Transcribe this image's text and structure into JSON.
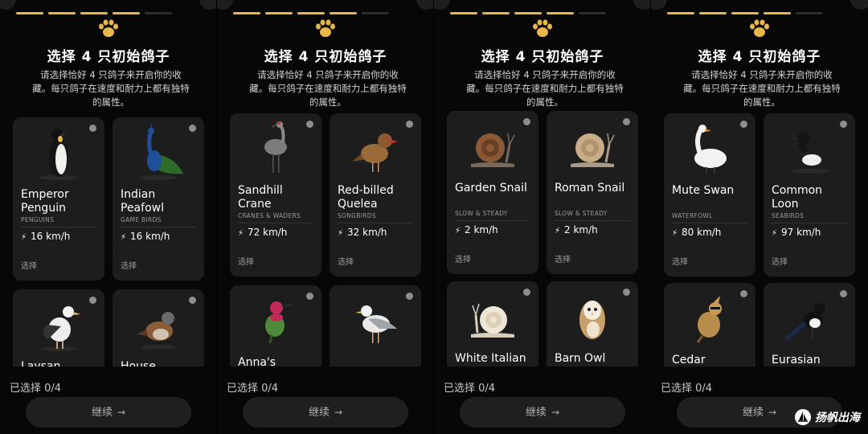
{
  "header": {
    "title": "选择 4 只初始鸽子",
    "subtitle": "请选择恰好 4 只鸽子来开启你的收藏。每只鸽子在速度和耐力上都有独特的属性。"
  },
  "common": {
    "choose_label": "选择",
    "selected_count": "已选择 0/4",
    "continue_label": "继续",
    "progress": {
      "filled": 4,
      "total": 5
    },
    "accent_color": "#e8b64a",
    "icons": {
      "paw": "paw-icon",
      "bolt": "bolt-icon",
      "arrow": "arrow-right-icon"
    }
  },
  "panels": [
    {
      "cards": [
        {
          "name": "Emperor Penguin",
          "category": "PENGUINS",
          "speed": "16 km/h",
          "icon": "penguin-icon"
        },
        {
          "name": "Indian Peafowl",
          "category": "GAME BIRDS",
          "speed": "16 km/h",
          "icon": "peafowl-icon"
        },
        {
          "name": "Laysan",
          "icon": "albatross-icon"
        },
        {
          "name": "House",
          "icon": "sparrow-icon"
        }
      ]
    },
    {
      "cards": [
        {
          "name": "Sandhill Crane",
          "category": "CRANES & WADERS",
          "speed": "72 km/h",
          "icon": "crane-icon"
        },
        {
          "name": "Red-billed Quelea",
          "category": "SONGBIRDS",
          "speed": "32 km/h",
          "icon": "quelea-icon"
        },
        {
          "name": "Anna's",
          "icon": "hummingbird-icon"
        },
        {
          "name": "",
          "icon": "gull-icon"
        }
      ]
    },
    {
      "cards": [
        {
          "name": "Garden Snail",
          "category": "SLOW & STEADY",
          "speed": "2 km/h",
          "icon": "snail-icon"
        },
        {
          "name": "Roman Snail",
          "category": "SLOW & STEADY",
          "speed": "2 km/h",
          "icon": "snail-icon"
        },
        {
          "name": "White Italian",
          "icon": "white-snail-icon"
        },
        {
          "name": "Barn Owl",
          "icon": "owl-icon"
        }
      ]
    },
    {
      "cards": [
        {
          "name": "Mute Swan",
          "category": "WATERFOWL",
          "speed": "80 km/h",
          "icon": "swan-icon"
        },
        {
          "name": "Common Loon",
          "category": "SEABIRDS",
          "speed": "97 km/h",
          "icon": "loon-icon"
        },
        {
          "name": "Cedar",
          "icon": "waxwing-icon"
        },
        {
          "name": "Eurasian",
          "icon": "magpie-icon"
        }
      ]
    }
  ],
  "watermark": {
    "text": "扬帆出海"
  }
}
